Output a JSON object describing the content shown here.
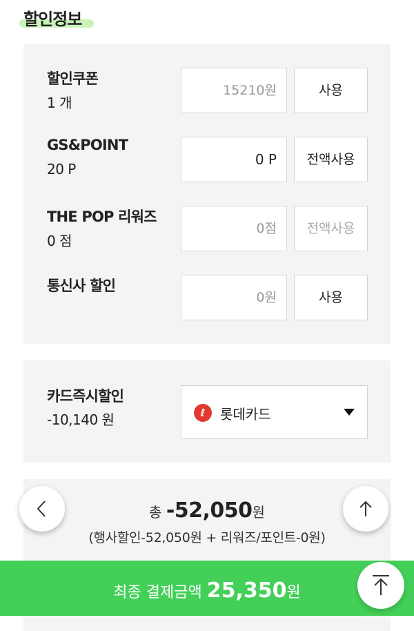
{
  "section": {
    "title": "할인정보"
  },
  "discounts": [
    {
      "label": "할인쿠폰",
      "sub": "1 개",
      "value": "15210원",
      "button": "사용"
    },
    {
      "label": "GS&POINT",
      "sub": "20 P",
      "value": "0 P",
      "button": "전액사용"
    },
    {
      "label": "THE POP 리워즈",
      "sub": "0 점",
      "value": "0점",
      "button": "전액사용"
    },
    {
      "label": "통신사 할인",
      "sub": "",
      "value": "0원",
      "button": "사용"
    }
  ],
  "card": {
    "label": "카드즉시할인",
    "sub": "-10,140 원",
    "logo_char": "ℓ",
    "selected": "롯데카드"
  },
  "summary": {
    "total_prefix": "총 ",
    "total_amount": "-52,050",
    "total_unit": "원",
    "breakdown": "(행사할인-52,050원 + 리워즈/포인트-0원)"
  },
  "final": {
    "label": "최종 결제금액 ",
    "amount": "25,350",
    "unit": "원"
  },
  "colors": {
    "accent_green": "#44cf58",
    "title_highlight": "#c9f3b9",
    "card_red": "#e03a2f"
  },
  "icons": {
    "back": "chevron-left-icon",
    "up": "arrow-up-icon",
    "top": "scroll-top-icon"
  }
}
